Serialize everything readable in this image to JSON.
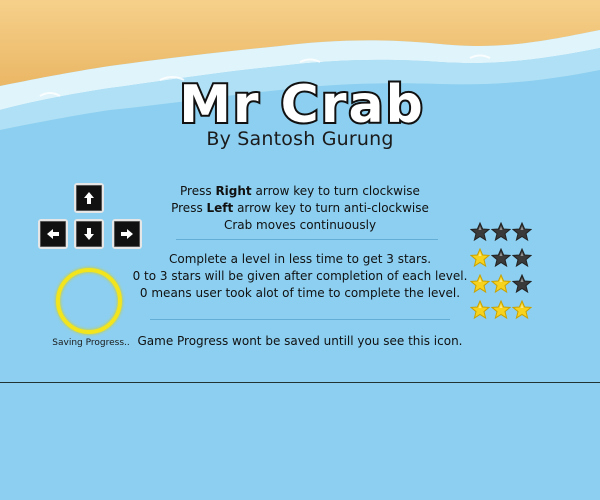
{
  "title": "Mr Crab",
  "author": "By  Santosh Gurung",
  "instructions": {
    "line1_pre": "Press ",
    "line1_key": "Right",
    "line1_post": " arrow key to turn clockwise",
    "line2_pre": "Press ",
    "line2_key": "Left",
    "line2_post": " arrow key to turn anti-clockwise",
    "line3": "Crab moves continuously"
  },
  "rating_info": {
    "line1": "Complete a level in less time to get 3 stars.",
    "line2": "0 to 3 stars will be given after completion of each level.",
    "line3": "0 means user took alot of time to complete the level."
  },
  "saving": {
    "label": "Saving Progress..",
    "note": "Game Progress wont be saved untill you see this icon."
  },
  "keys": [
    "up-arrow-key",
    "left-arrow-key",
    "down-arrow-key",
    "right-arrow-key"
  ],
  "star_ratings": [
    0,
    1,
    2,
    3
  ],
  "colors": {
    "water": "#8ccff0",
    "sand": "#f4c77a",
    "star_gold": "#f7d31e",
    "star_grey": "#3a3a3a",
    "ring": "#f2e51d"
  }
}
